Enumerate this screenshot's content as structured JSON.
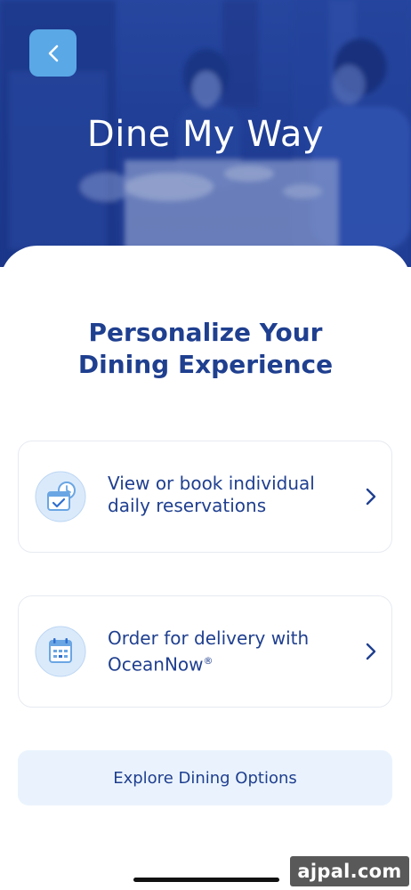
{
  "header": {
    "title": "Dine My Way"
  },
  "main": {
    "heading_line1": "Personalize Your",
    "heading_line2": "Dining Experience",
    "options": [
      {
        "line1": "View or book individual",
        "line2": "daily reservations",
        "icon": "calendar-check-icon"
      },
      {
        "line1": "Order for delivery with",
        "line2": "OceanNow",
        "trademark": "®",
        "icon": "calendar-grid-icon"
      }
    ],
    "explore_label": "Explore Dining Options"
  },
  "watermark": "ajpal.com",
  "colors": {
    "primary": "#1f3f8f",
    "hero": "#223f97",
    "back_button": "#5aa8e6",
    "icon_bg": "#dbeafb",
    "explore_bg": "#eaf3fd",
    "card_border": "#e6eaf0"
  }
}
